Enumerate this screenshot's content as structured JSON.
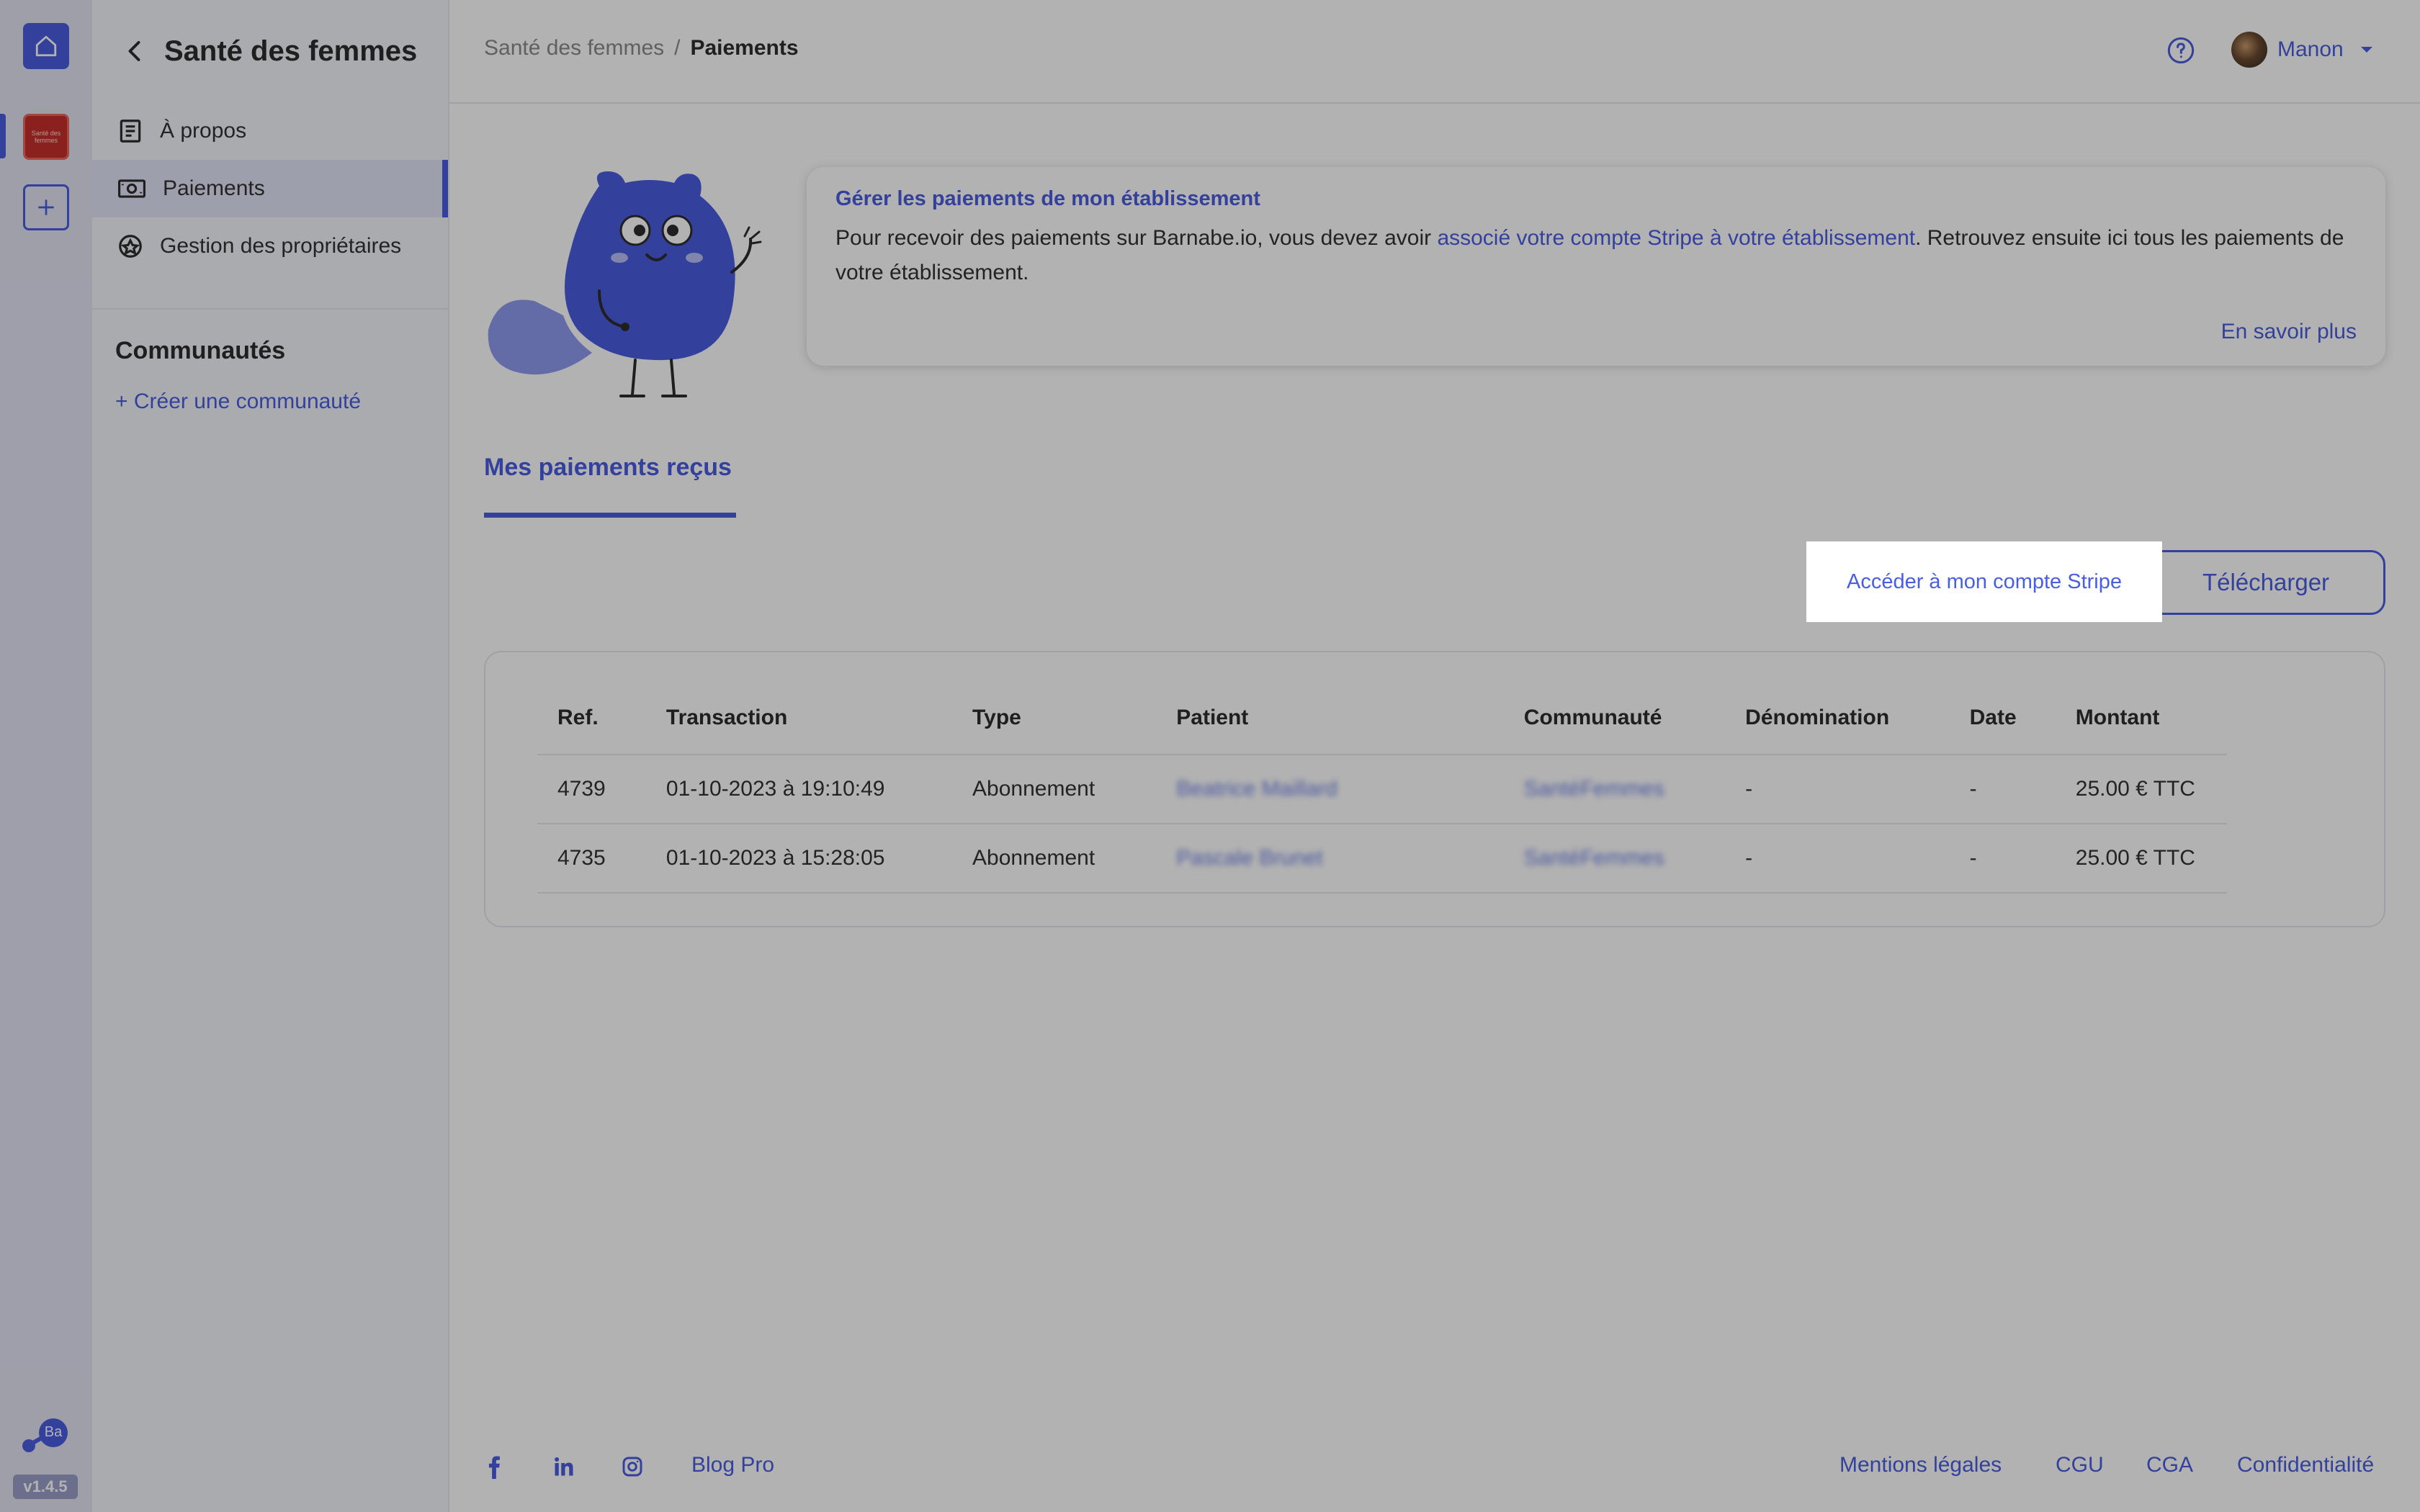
{
  "app": {
    "version": "v1.4.5"
  },
  "rail": {
    "community_badge": "Santé des femmes",
    "logo_text": "Ba"
  },
  "sidebar": {
    "title": "Santé des femmes",
    "items": [
      {
        "label": "À propos",
        "icon": "document-icon"
      },
      {
        "label": "Paiements",
        "icon": "banknote-icon",
        "active": true
      },
      {
        "label": "Gestion des propriétaires",
        "icon": "owner-badge-icon"
      }
    ],
    "section_title": "Communautés",
    "create_label": "+ Créer une communauté"
  },
  "breadcrumb": {
    "parent": "Santé des femmes",
    "separator": "/",
    "current": "Paiements"
  },
  "user": {
    "name": "Manon"
  },
  "info": {
    "title": "Gérer les paiements de mon établissement",
    "text_before": "Pour recevoir des paiements sur Barnabe.io, vous devez avoir ",
    "link": "associé votre compte Stripe à votre établissement",
    "text_after": ". Retrouvez ensuite ici tous les paiements de votre établissement.",
    "more": "En savoir plus"
  },
  "tab": {
    "label": "Mes paiements reçus"
  },
  "actions": {
    "stripe": "Accéder à mon compte Stripe",
    "download": "Télécharger"
  },
  "table": {
    "columns": [
      "Ref.",
      "Transaction",
      "Type",
      "Patient",
      "Communauté",
      "Dénomination",
      "Date",
      "Montant"
    ],
    "rows": [
      [
        "4739",
        "01-10-2023 à 19:10:49",
        "Abonnement",
        "Beatrice Maillard",
        "SantéFemmes",
        "-",
        "-",
        "25.00 € TTC"
      ],
      [
        "4735",
        "01-10-2023 à 15:28:05",
        "Abonnement",
        "Pascale Brunet",
        "SantéFemmes",
        "-",
        "-",
        "25.00 € TTC"
      ]
    ]
  },
  "footer": {
    "blog": "Blog Pro",
    "links": [
      "Mentions légales",
      "CGU",
      "CGA",
      "Confidentialité"
    ]
  },
  "colors": {
    "accent": "#4a5ee0",
    "sidebar_bg": "#f4f5fb",
    "rail_bg": "#e3e4f3",
    "overlay": "rgba(0,0,0,0.30)"
  }
}
